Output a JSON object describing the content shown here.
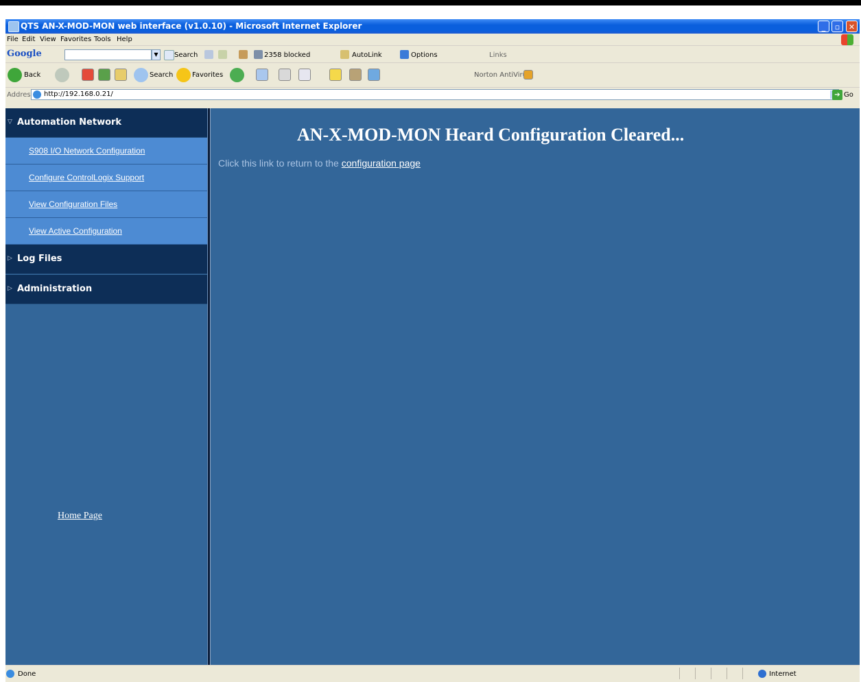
{
  "window": {
    "title": "QTS AN-X-MOD-MON web interface (v1.0.10) - Microsoft Internet Explorer",
    "controls": [
      "minimize",
      "maximize",
      "close"
    ]
  },
  "menu": [
    "File",
    "Edit",
    "View",
    "Favorites",
    "Tools",
    "Help"
  ],
  "google_toolbar": {
    "logo": "Google",
    "search_label": "Search",
    "blocked": "2358 blocked",
    "autolink": "AutoLink",
    "options": "Options",
    "links": "Links"
  },
  "std_toolbar": {
    "back": "Back",
    "search": "Search",
    "favorites": "Favorites",
    "norton": "Norton AntiVirus"
  },
  "address": {
    "label": "Address",
    "url": "http://192.168.0.21/",
    "go": "Go"
  },
  "sidebar": {
    "sections": [
      {
        "title": "Automation Network",
        "expanded": true,
        "items": [
          "S908 I/O Network Configuration",
          "Configure ControlLogix Support",
          "View Configuration Files",
          "View Active Configuration"
        ]
      },
      {
        "title": "Log Files",
        "expanded": false
      },
      {
        "title": "Administration",
        "expanded": false
      }
    ],
    "home_link": "Home Page"
  },
  "main": {
    "heading": "AN-X-MOD-MON Heard Configuration Cleared...",
    "message": "Click this link to return to the",
    "link": "configuration page"
  },
  "status": {
    "text": "Done",
    "zone": "Internet"
  },
  "colors": {
    "content_bg": "#336699",
    "section_head_bg": "#0d2e57",
    "sub_item_bg": "#4d8bd3",
    "titlebar": "#0a5fdd"
  }
}
